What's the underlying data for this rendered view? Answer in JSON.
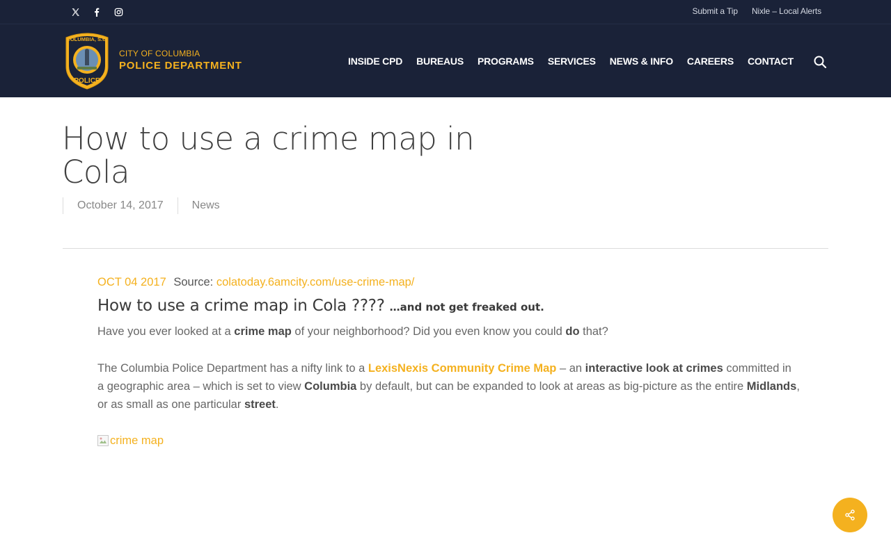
{
  "topbar": {
    "social": [
      {
        "icon": "x-twitter-icon"
      },
      {
        "icon": "facebook-icon"
      },
      {
        "icon": "instagram-icon"
      }
    ],
    "links": [
      "Submit a Tip",
      "Nixle – Local Alerts"
    ]
  },
  "header": {
    "logo": {
      "seal_top": "COLUMBIA, S.C.",
      "seal_bottom": "POLICE"
    },
    "brand_line1": "CITY OF COLUMBIA",
    "brand_line2": "POLICE DEPARTMENT",
    "nav": [
      "INSIDE CPD",
      "BUREAUS",
      "PROGRAMS",
      "SERVICES",
      "NEWS & INFO",
      "CAREERS",
      "CONTACT"
    ],
    "search_icon": "search-icon"
  },
  "post": {
    "title": "How to use a crime map in Cola",
    "date": "October 14, 2017",
    "category": "News"
  },
  "article": {
    "date_tag": "OCT 04 2017",
    "source_label": "Source:",
    "source_link": "colatoday.6amcity.com/use-crime-map/",
    "heading": "How to use a crime map in Cola ????",
    "heading_small": "…and not get freaked out.",
    "p1": {
      "t1": "Have you ever looked at a ",
      "b1": "crime map",
      "t2": " of your neighborhood? Did you even know you could ",
      "b2": "do",
      "t3": " that?"
    },
    "p2": {
      "t1": "The Columbia Police Department has a nifty link to a ",
      "link": "LexisNexis Community Crime Map",
      "t2": " – an ",
      "b1": "interactive look at crimes",
      "t3": " committed in a geographic area – which is set to view ",
      "b2": "Columbia",
      "t4": " by default, but can be expanded to look at areas as big-picture as the entire ",
      "b3": "Midlands",
      "t5": ", or as small as one particular ",
      "b4": "street",
      "t6": "."
    },
    "image_alt": "crime map"
  },
  "share_button": {
    "icon": "share-icon"
  },
  "colors": {
    "navy": "#1a2238",
    "gold": "#f4b11f",
    "white": "#ffffff"
  }
}
